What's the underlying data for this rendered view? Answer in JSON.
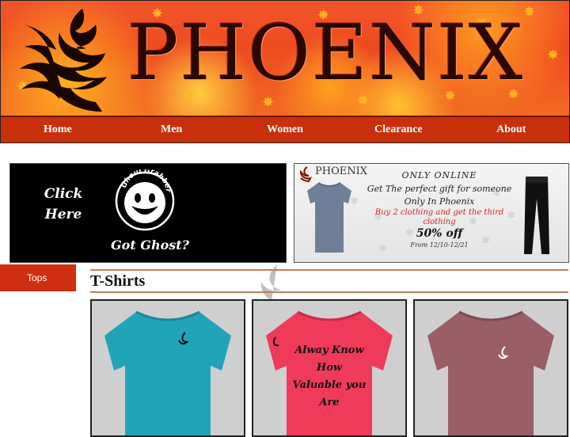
{
  "header": {
    "brand": "PHOENIX"
  },
  "nav": {
    "items": [
      "Home",
      "Men",
      "Women",
      "Clearance",
      "About"
    ]
  },
  "ads": {
    "left": {
      "click_text_line1": "Click",
      "click_text_line2": "Here",
      "brand_arc": "Ghoul Grabbers",
      "tagline": "Got Ghost?"
    },
    "right": {
      "brand": "PHOENIX",
      "line1": "ONLY ONLINE",
      "line2": "Get The perfect gift for someone",
      "line3": "Only In Phoenix",
      "line4": "Buy 2 clothing and get the third",
      "line5": "clothing",
      "discount": "50% off",
      "dates": "From 12/10-12/21"
    }
  },
  "sidebar": {
    "tab": "Tops"
  },
  "section": {
    "title": "T-Shirts"
  },
  "products": [
    {
      "color": "#20a4b8",
      "print": ""
    },
    {
      "color": "#f03a5a",
      "print_lines": [
        "Alway Know",
        "How",
        "Valuable you",
        "Are"
      ]
    },
    {
      "color": "#9a5e66",
      "print": ""
    }
  ],
  "colors": {
    "nav_bg": "#c8300c",
    "accent": "#cf2f10"
  }
}
